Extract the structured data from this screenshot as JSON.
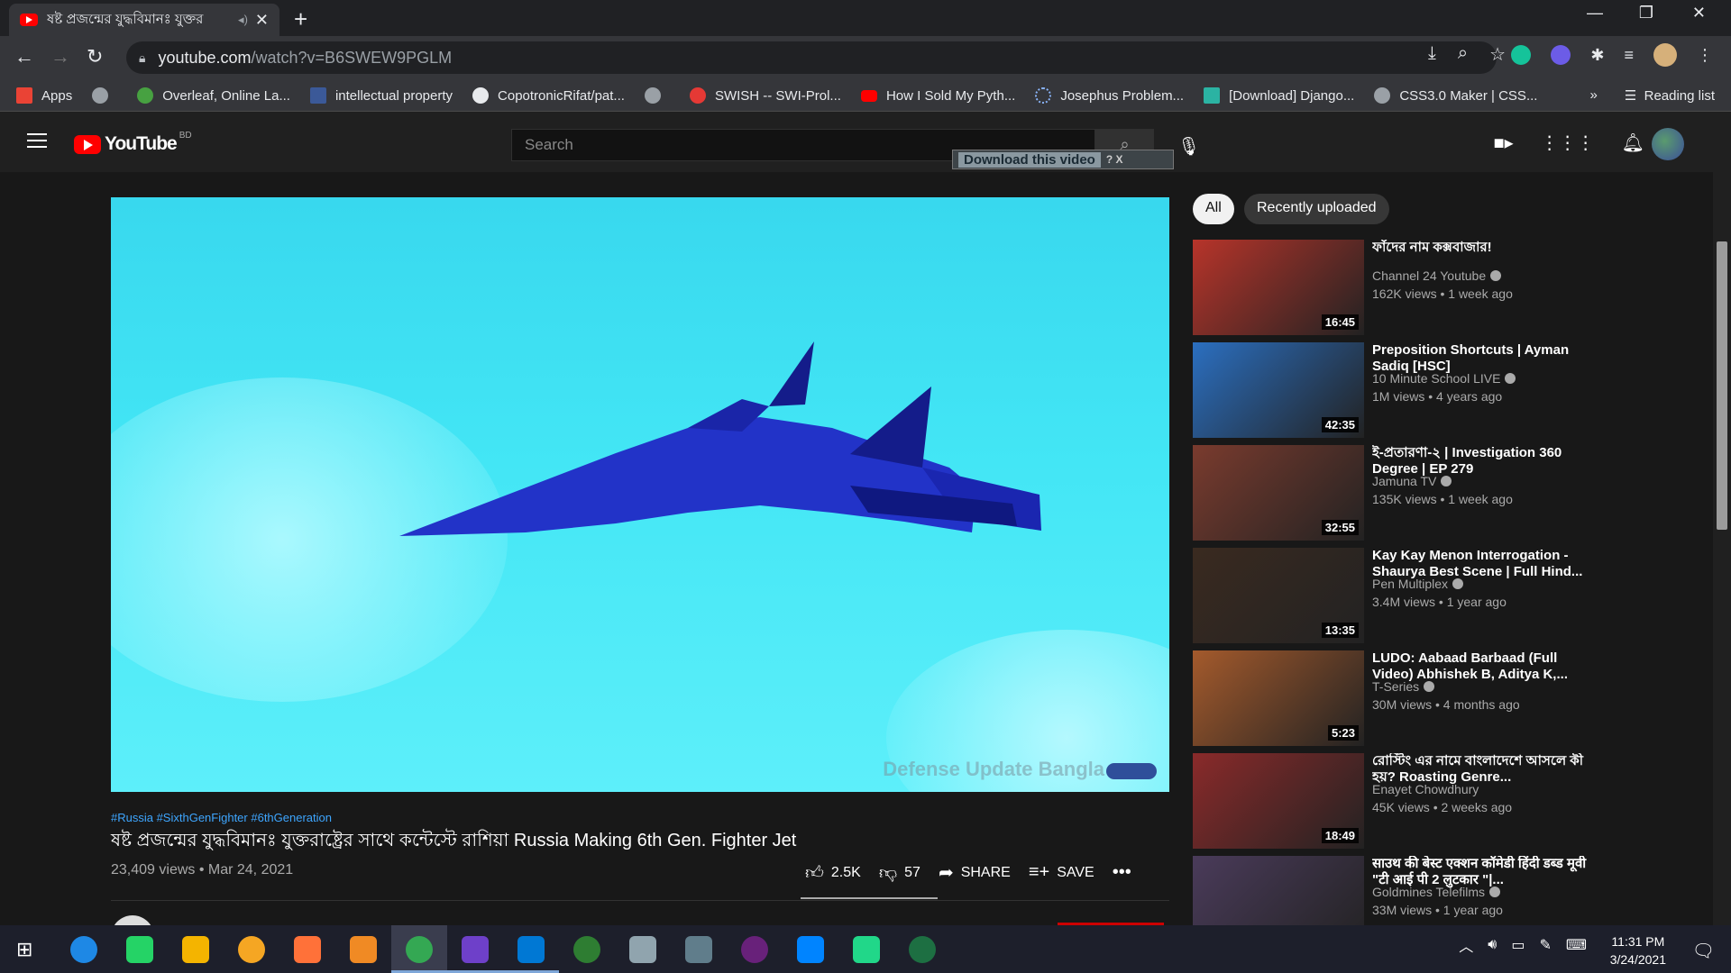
{
  "browser": {
    "tab_title": "ষষ্ট প্রজন্মের যুদ্ধবিমানঃ যুক্তর",
    "url_host": "youtube.com",
    "url_path": "/watch?v=B6SWEW9PGLM",
    "bookmarks": [
      {
        "label": "Apps",
        "color": "#ea4335"
      },
      {
        "label": "",
        "color": "#9aa0a6"
      },
      {
        "label": "Overleaf, Online La...",
        "color": "#47a141"
      },
      {
        "label": "intellectual property",
        "color": "#3b5998"
      },
      {
        "label": "CopotronicRifat/pat...",
        "color": "#e8eaed"
      },
      {
        "label": "",
        "color": "#9aa0a6"
      },
      {
        "label": "SWISH -- SWI-Prol...",
        "color": "#e53935"
      },
      {
        "label": "How I Sold My Pyth...",
        "color": "#ff0000"
      },
      {
        "label": "Josephus Problem...",
        "color": "#8ab4f8"
      },
      {
        "label": "[Download] Django...",
        "color": "#2bb3a3"
      },
      {
        "label": "CSS3.0 Maker | CSS...",
        "color": "#9aa0a6"
      }
    ],
    "reading_list": "Reading list"
  },
  "youtube": {
    "country_code": "BD",
    "search_placeholder": "Search",
    "download_label": "Download this video",
    "download_help": "? X"
  },
  "video": {
    "watermark": "Defense Update Bangla",
    "hashtags": "#Russia #SixthGenFighter #6thGeneration",
    "title": "ষষ্ট প্রজন্মের যুদ্ধবিমানঃ যুক্তরাষ্ট্রের সাথে কন্টেস্টে রাশিয়া Russia Making 6th Gen. Fighter Jet",
    "meta": "23,409 views • Mar 24, 2021",
    "likes": "2.5K",
    "dislikes": "57",
    "share": "SHARE",
    "save": "SAVE"
  },
  "chips": {
    "all": "All",
    "recent": "Recently uploaded"
  },
  "recommendations": [
    {
      "title": "ফাঁদের নাম কক্সবাজার!",
      "channel": "Channel 24 Youtube",
      "verified": true,
      "views": "162K views • 1 week ago",
      "duration": "16:45",
      "thumb": "#b7342a"
    },
    {
      "title": "Preposition Shortcuts | Ayman Sadiq [HSC]",
      "channel": "10 Minute School LIVE",
      "verified": true,
      "views": "1M views • 4 years ago",
      "duration": "42:35",
      "thumb": "#2b6fc0"
    },
    {
      "title": "ই-প্রতারণা-২ | Investigation 360 Degree | EP 279",
      "channel": "Jamuna TV",
      "verified": true,
      "views": "135K views • 1 week ago",
      "duration": "32:55",
      "thumb": "#7a3b2e"
    },
    {
      "title": "Kay Kay Menon Interrogation - Shaurya Best Scene | Full Hind...",
      "channel": "Pen Multiplex",
      "verified": true,
      "views": "3.4M views • 1 year ago",
      "duration": "13:35",
      "thumb": "#3a2a20"
    },
    {
      "title": "LUDO: Aabaad Barbaad (Full Video) Abhishek B, Aditya K,...",
      "channel": "T-Series",
      "verified": true,
      "views": "30M views • 4 months ago",
      "duration": "5:23",
      "thumb": "#a45a2c"
    },
    {
      "title": "রোস্টিং এর নামে বাংলাদেশে আসলে কী হয়? Roasting Genre...",
      "channel": "Enayet Chowdhury",
      "verified": false,
      "views": "45K views • 2 weeks ago",
      "duration": "18:49",
      "thumb": "#8a2a2a"
    },
    {
      "title": "साउथ की बेस्ट एक्शन कॉमेडी हिंदी डब्ड मूवी \"टी आई पी 2 लुटकार \"|...",
      "channel": "Goldmines Telefilms",
      "verified": true,
      "views": "33M views • 1 year ago",
      "duration": "",
      "thumb": "#4a3b5a"
    }
  ],
  "taskbar": {
    "time": "11:31 PM",
    "date": "3/24/2021"
  }
}
